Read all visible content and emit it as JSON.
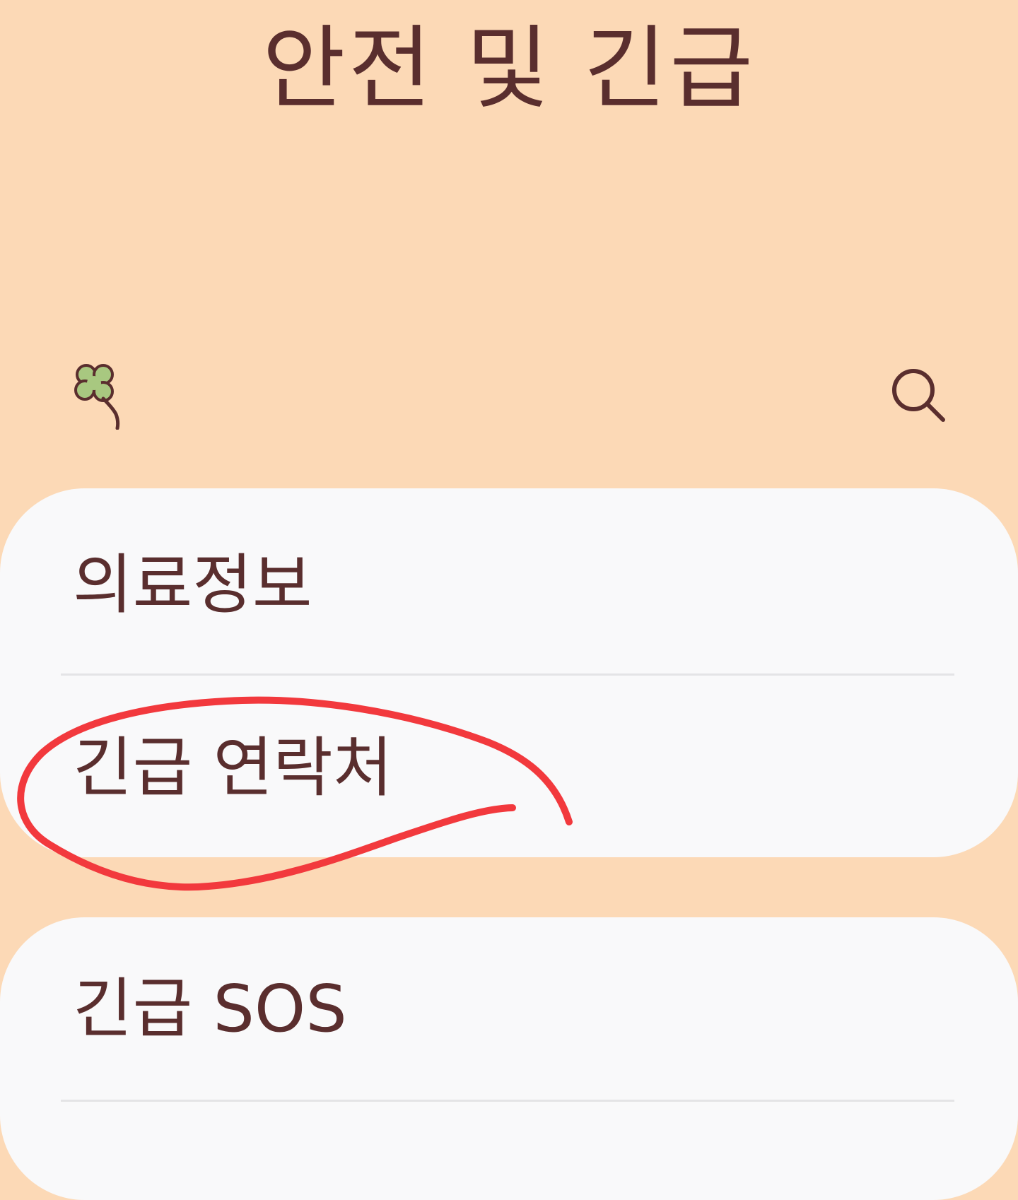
{
  "header": {
    "title": "안전 및 긴급"
  },
  "toolbar": {
    "left_icon": "clover-icon",
    "right_icon": "search-icon"
  },
  "sections": [
    {
      "items": [
        {
          "label": "의료정보"
        },
        {
          "label": "긴급 연락처"
        }
      ]
    },
    {
      "items": [
        {
          "label": "긴급 SOS"
        }
      ]
    }
  ],
  "colors": {
    "background": "#FCD9B6",
    "card": "#F9F9FA",
    "text": "#5A2E2E",
    "divider": "#E4E4E6",
    "annotation": "#F2393D",
    "clover": "#A8C880"
  }
}
